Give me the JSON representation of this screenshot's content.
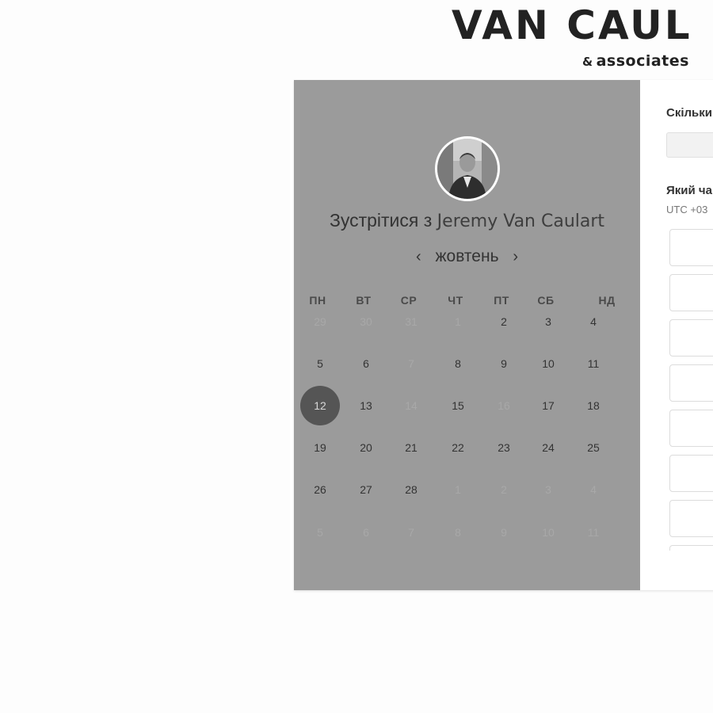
{
  "logo": {
    "main": "VAN CAUL",
    "sub_amp": "&",
    "sub": "associates"
  },
  "scheduler": {
    "title_prefix": "Зустрітися з",
    "host_name": "Jeremy Van Caulart",
    "month": "жовтень",
    "prev_icon": "chevron-left-icon",
    "next_icon": "chevron-right-icon",
    "weekdays": [
      "ПН",
      "ВТ",
      "СР",
      "ЧТ",
      "ПТ",
      "СБ",
      "НД"
    ],
    "weeks": [
      [
        {
          "d": "29",
          "m": true
        },
        {
          "d": "30",
          "m": true
        },
        {
          "d": "31",
          "m": true
        },
        {
          "d": "1",
          "m": true
        },
        {
          "d": "2",
          "m": false
        },
        {
          "d": "3",
          "m": false
        },
        {
          "d": "4",
          "m": false
        }
      ],
      [
        {
          "d": "5",
          "m": false
        },
        {
          "d": "6",
          "m": false
        },
        {
          "d": "7",
          "m": true
        },
        {
          "d": "8",
          "m": false
        },
        {
          "d": "9",
          "m": false
        },
        {
          "d": "10",
          "m": false
        },
        {
          "d": "11",
          "m": false
        }
      ],
      [
        {
          "d": "12",
          "m": false,
          "selected": true
        },
        {
          "d": "13",
          "m": false
        },
        {
          "d": "14",
          "m": true
        },
        {
          "d": "15",
          "m": false
        },
        {
          "d": "16",
          "m": true
        },
        {
          "d": "17",
          "m": false
        },
        {
          "d": "18",
          "m": false
        }
      ],
      [
        {
          "d": "19",
          "m": false
        },
        {
          "d": "20",
          "m": false
        },
        {
          "d": "21",
          "m": false
        },
        {
          "d": "22",
          "m": false
        },
        {
          "d": "23",
          "m": false
        },
        {
          "d": "24",
          "m": false
        },
        {
          "d": "25",
          "m": false
        }
      ],
      [
        {
          "d": "26",
          "m": false
        },
        {
          "d": "27",
          "m": false
        },
        {
          "d": "28",
          "m": false
        },
        {
          "d": "1",
          "m": true
        },
        {
          "d": "2",
          "m": true
        },
        {
          "d": "3",
          "m": true
        },
        {
          "d": "4",
          "m": true
        }
      ],
      [
        {
          "d": "5",
          "m": true
        },
        {
          "d": "6",
          "m": true
        },
        {
          "d": "7",
          "m": true
        },
        {
          "d": "8",
          "m": true
        },
        {
          "d": "9",
          "m": true
        },
        {
          "d": "10",
          "m": true
        },
        {
          "d": "11",
          "m": true
        }
      ]
    ]
  },
  "booking": {
    "duration_question": "Скільки",
    "time_question": "Який ча",
    "timezone": "UTC +03",
    "slot_count": 8
  },
  "colors": {
    "overlay": "#9b9b9b",
    "selected_day": "#555555"
  }
}
